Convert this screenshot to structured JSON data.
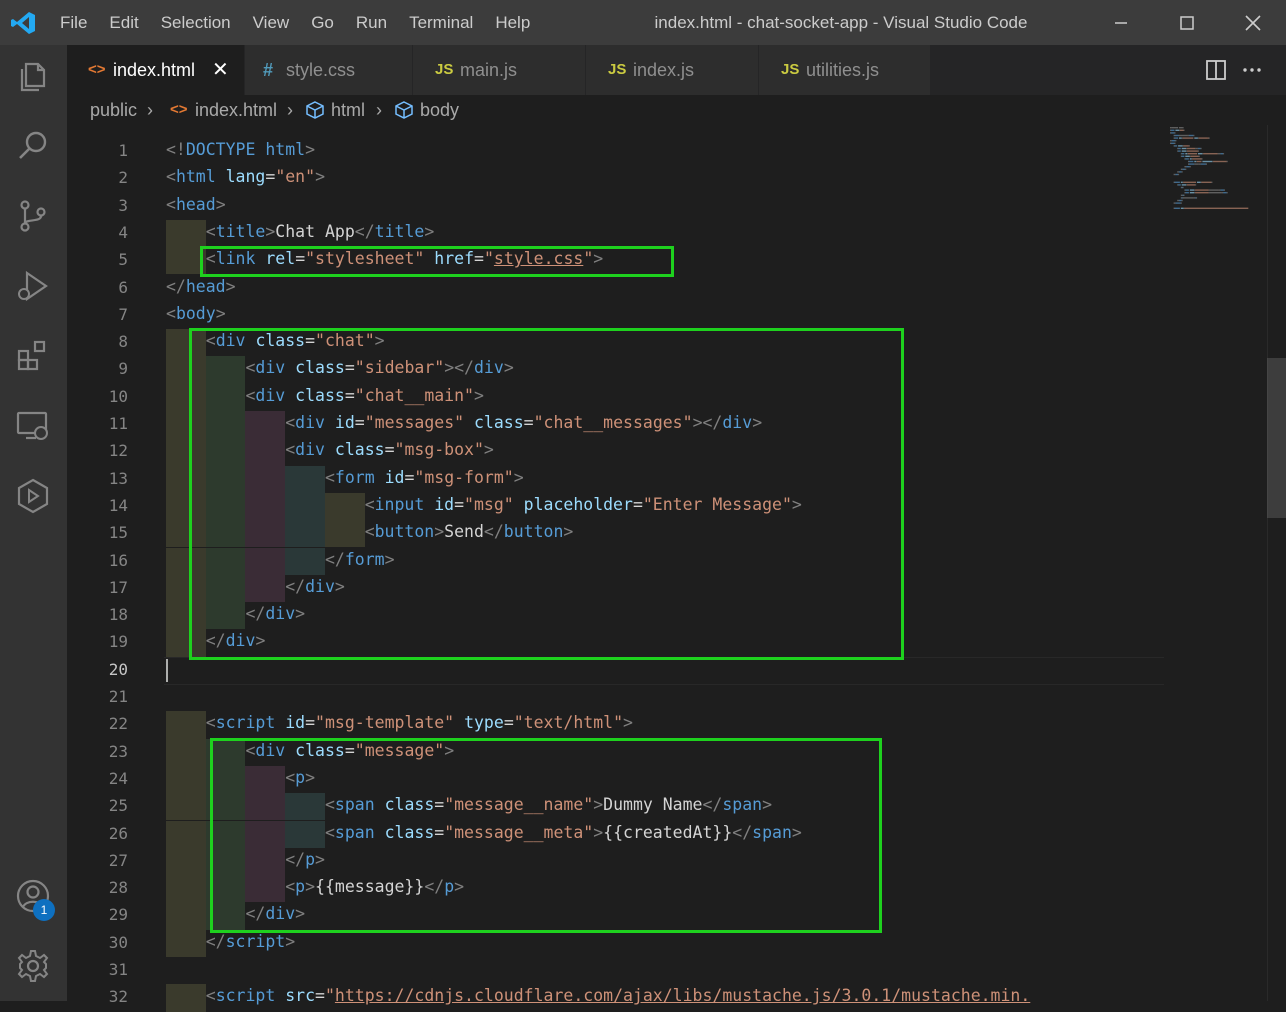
{
  "window": {
    "title": "index.html - chat-socket-app - Visual Studio Code"
  },
  "menu": [
    "File",
    "Edit",
    "Selection",
    "View",
    "Go",
    "Run",
    "Terminal",
    "Help"
  ],
  "tabs": [
    {
      "icon": "<>",
      "label": "index.html",
      "active": true,
      "icon_color": "#e37933"
    },
    {
      "icon": "#",
      "label": "style.css",
      "icon_color": "#519aba"
    },
    {
      "icon": "JS",
      "label": "main.js",
      "icon_color": "#cbcb41"
    },
    {
      "icon": "JS",
      "label": "index.js",
      "icon_color": "#cbcb41"
    },
    {
      "icon": "JS",
      "label": "utilities.js",
      "icon_color": "#cbcb41"
    }
  ],
  "breadcrumbs": [
    "public",
    "index.html",
    "html",
    "body"
  ],
  "activity_badge": "1",
  "editor": {
    "current_line": 20,
    "lines": [
      [
        [
          "t-br",
          "<!"
        ],
        [
          "t-dt",
          "DOCTYPE"
        ],
        [
          "t-txt",
          " "
        ],
        [
          "t-dtn",
          "html"
        ],
        [
          "t-br",
          ">"
        ]
      ],
      [
        [
          "t-br",
          "<"
        ],
        [
          "t-tag",
          "html"
        ],
        [
          "t-txt",
          " "
        ],
        [
          "t-attr",
          "lang"
        ],
        [
          "t-txt",
          "="
        ],
        [
          "t-str",
          "\"en\""
        ],
        [
          "t-br",
          ">"
        ]
      ],
      [
        [
          "t-br",
          "<"
        ],
        [
          "t-tag",
          "head"
        ],
        [
          "t-br",
          ">"
        ]
      ],
      [
        [
          "t-txt",
          "    "
        ],
        [
          "t-br",
          "<"
        ],
        [
          "t-tag",
          "title"
        ],
        [
          "t-br",
          ">"
        ],
        [
          "t-txt",
          "Chat App"
        ],
        [
          "t-br",
          "</"
        ],
        [
          "t-tag",
          "title"
        ],
        [
          "t-br",
          ">"
        ]
      ],
      [
        [
          "t-txt",
          "    "
        ],
        [
          "t-br",
          "<"
        ],
        [
          "t-tag",
          "link"
        ],
        [
          "t-txt",
          " "
        ],
        [
          "t-attr",
          "rel"
        ],
        [
          "t-txt",
          "="
        ],
        [
          "t-str",
          "\"stylesheet\""
        ],
        [
          "t-txt",
          " "
        ],
        [
          "t-attr",
          "href"
        ],
        [
          "t-txt",
          "="
        ],
        [
          "t-str",
          "\""
        ],
        [
          "t-str squig",
          "style.css"
        ],
        [
          "t-str",
          "\""
        ],
        [
          "t-br",
          ">"
        ]
      ],
      [
        [
          "t-br",
          "</"
        ],
        [
          "t-tag",
          "head"
        ],
        [
          "t-br",
          ">"
        ]
      ],
      [
        [
          "t-br",
          "<"
        ],
        [
          "t-tag",
          "body"
        ],
        [
          "t-br",
          ">"
        ]
      ],
      [
        [
          "t-txt",
          "    "
        ],
        [
          "t-br",
          "<"
        ],
        [
          "t-tag",
          "div"
        ],
        [
          "t-txt",
          " "
        ],
        [
          "t-attr",
          "class"
        ],
        [
          "t-txt",
          "="
        ],
        [
          "t-str",
          "\"chat\""
        ],
        [
          "t-br",
          ">"
        ]
      ],
      [
        [
          "t-txt",
          "        "
        ],
        [
          "t-br",
          "<"
        ],
        [
          "t-tag",
          "div"
        ],
        [
          "t-txt",
          " "
        ],
        [
          "t-attr",
          "class"
        ],
        [
          "t-txt",
          "="
        ],
        [
          "t-str",
          "\"sidebar\""
        ],
        [
          "t-br",
          "></"
        ],
        [
          "t-tag",
          "div"
        ],
        [
          "t-br",
          ">"
        ]
      ],
      [
        [
          "t-txt",
          "        "
        ],
        [
          "t-br",
          "<"
        ],
        [
          "t-tag",
          "div"
        ],
        [
          "t-txt",
          " "
        ],
        [
          "t-attr",
          "class"
        ],
        [
          "t-txt",
          "="
        ],
        [
          "t-str",
          "\"chat__main\""
        ],
        [
          "t-br",
          ">"
        ]
      ],
      [
        [
          "t-txt",
          "            "
        ],
        [
          "t-br",
          "<"
        ],
        [
          "t-tag",
          "div"
        ],
        [
          "t-txt",
          " "
        ],
        [
          "t-attr",
          "id"
        ],
        [
          "t-txt",
          "="
        ],
        [
          "t-str",
          "\"messages\""
        ],
        [
          "t-txt",
          " "
        ],
        [
          "t-attr",
          "class"
        ],
        [
          "t-txt",
          "="
        ],
        [
          "t-str",
          "\"chat__messages\""
        ],
        [
          "t-br",
          "></"
        ],
        [
          "t-tag",
          "div"
        ],
        [
          "t-br",
          ">"
        ]
      ],
      [
        [
          "t-txt",
          "            "
        ],
        [
          "t-br",
          "<"
        ],
        [
          "t-tag",
          "div"
        ],
        [
          "t-txt",
          " "
        ],
        [
          "t-attr",
          "class"
        ],
        [
          "t-txt",
          "="
        ],
        [
          "t-str",
          "\"msg-box\""
        ],
        [
          "t-br",
          ">"
        ]
      ],
      [
        [
          "t-txt",
          "                "
        ],
        [
          "t-br",
          "<"
        ],
        [
          "t-tag",
          "form"
        ],
        [
          "t-txt",
          " "
        ],
        [
          "t-attr",
          "id"
        ],
        [
          "t-txt",
          "="
        ],
        [
          "t-str",
          "\"msg-form\""
        ],
        [
          "t-br",
          ">"
        ]
      ],
      [
        [
          "t-txt",
          "                    "
        ],
        [
          "t-br",
          "<"
        ],
        [
          "t-tag",
          "input"
        ],
        [
          "t-txt",
          " "
        ],
        [
          "t-attr",
          "id"
        ],
        [
          "t-txt",
          "="
        ],
        [
          "t-str",
          "\"msg\""
        ],
        [
          "t-txt",
          " "
        ],
        [
          "t-attr",
          "placeholder"
        ],
        [
          "t-txt",
          "="
        ],
        [
          "t-str",
          "\"Enter Message\""
        ],
        [
          "t-br",
          ">"
        ]
      ],
      [
        [
          "t-txt",
          "                    "
        ],
        [
          "t-br",
          "<"
        ],
        [
          "t-tag",
          "button"
        ],
        [
          "t-br",
          ">"
        ],
        [
          "t-txt",
          "Send"
        ],
        [
          "t-br",
          "</"
        ],
        [
          "t-tag",
          "button"
        ],
        [
          "t-br",
          ">"
        ]
      ],
      [
        [
          "t-txt",
          "                "
        ],
        [
          "t-br",
          "</"
        ],
        [
          "t-tag",
          "form"
        ],
        [
          "t-br",
          ">"
        ]
      ],
      [
        [
          "t-txt",
          "            "
        ],
        [
          "t-br",
          "</"
        ],
        [
          "t-tag",
          "div"
        ],
        [
          "t-br",
          ">"
        ]
      ],
      [
        [
          "t-txt",
          "        "
        ],
        [
          "t-br",
          "</"
        ],
        [
          "t-tag",
          "div"
        ],
        [
          "t-br",
          ">"
        ]
      ],
      [
        [
          "t-txt",
          "    "
        ],
        [
          "t-br",
          "</"
        ],
        [
          "t-tag",
          "div"
        ],
        [
          "t-br",
          ">"
        ]
      ],
      [],
      [],
      [
        [
          "t-txt",
          "    "
        ],
        [
          "t-br",
          "<"
        ],
        [
          "t-tag",
          "script"
        ],
        [
          "t-txt",
          " "
        ],
        [
          "t-attr",
          "id"
        ],
        [
          "t-txt",
          "="
        ],
        [
          "t-str",
          "\"msg-template\""
        ],
        [
          "t-txt",
          " "
        ],
        [
          "t-attr",
          "type"
        ],
        [
          "t-txt",
          "="
        ],
        [
          "t-str",
          "\"text/html\""
        ],
        [
          "t-br",
          ">"
        ]
      ],
      [
        [
          "t-txt",
          "        "
        ],
        [
          "t-br",
          "<"
        ],
        [
          "t-tag",
          "div"
        ],
        [
          "t-txt",
          " "
        ],
        [
          "t-attr",
          "class"
        ],
        [
          "t-txt",
          "="
        ],
        [
          "t-str",
          "\"message\""
        ],
        [
          "t-br",
          ">"
        ]
      ],
      [
        [
          "t-txt",
          "            "
        ],
        [
          "t-br",
          "<"
        ],
        [
          "t-tag",
          "p"
        ],
        [
          "t-br",
          ">"
        ]
      ],
      [
        [
          "t-txt",
          "                "
        ],
        [
          "t-br",
          "<"
        ],
        [
          "t-tag",
          "span"
        ],
        [
          "t-txt",
          " "
        ],
        [
          "t-attr",
          "class"
        ],
        [
          "t-txt",
          "="
        ],
        [
          "t-str",
          "\"message__name\""
        ],
        [
          "t-br",
          ">"
        ],
        [
          "t-txt",
          "Dummy Name"
        ],
        [
          "t-br",
          "</"
        ],
        [
          "t-tag",
          "span"
        ],
        [
          "t-br",
          ">"
        ]
      ],
      [
        [
          "t-txt",
          "                "
        ],
        [
          "t-br",
          "<"
        ],
        [
          "t-tag",
          "span"
        ],
        [
          "t-txt",
          " "
        ],
        [
          "t-attr",
          "class"
        ],
        [
          "t-txt",
          "="
        ],
        [
          "t-str",
          "\"message__meta\""
        ],
        [
          "t-br",
          ">"
        ],
        [
          "t-txt",
          "{{createdAt}}"
        ],
        [
          "t-br",
          "</"
        ],
        [
          "t-tag",
          "span"
        ],
        [
          "t-br",
          ">"
        ]
      ],
      [
        [
          "t-txt",
          "            "
        ],
        [
          "t-br",
          "</"
        ],
        [
          "t-tag",
          "p"
        ],
        [
          "t-br",
          ">"
        ]
      ],
      [
        [
          "t-txt",
          "            "
        ],
        [
          "t-br",
          "<"
        ],
        [
          "t-tag",
          "p"
        ],
        [
          "t-br",
          ">"
        ],
        [
          "t-txt",
          "{{message}}"
        ],
        [
          "t-br",
          "</"
        ],
        [
          "t-tag",
          "p"
        ],
        [
          "t-br",
          ">"
        ]
      ],
      [
        [
          "t-txt",
          "        "
        ],
        [
          "t-br",
          "</"
        ],
        [
          "t-tag",
          "div"
        ],
        [
          "t-br",
          ">"
        ]
      ],
      [
        [
          "t-txt",
          "    "
        ],
        [
          "t-br",
          "</"
        ],
        [
          "t-tag",
          "script"
        ],
        [
          "t-br",
          ">"
        ]
      ],
      [],
      [
        [
          "t-txt",
          "    "
        ],
        [
          "t-br",
          "<"
        ],
        [
          "t-tag",
          "script"
        ],
        [
          "t-txt",
          " "
        ],
        [
          "t-attr",
          "src"
        ],
        [
          "t-txt",
          "="
        ],
        [
          "t-str",
          "\""
        ],
        [
          "t-str squig",
          "https://cdnjs.cloudflare.com/ajax/libs/mustache.js/3.0.1/mustache.min."
        ]
      ]
    ]
  },
  "colors": {
    "highlight_box": "#1ed11e",
    "accent": "#0e70c0"
  }
}
